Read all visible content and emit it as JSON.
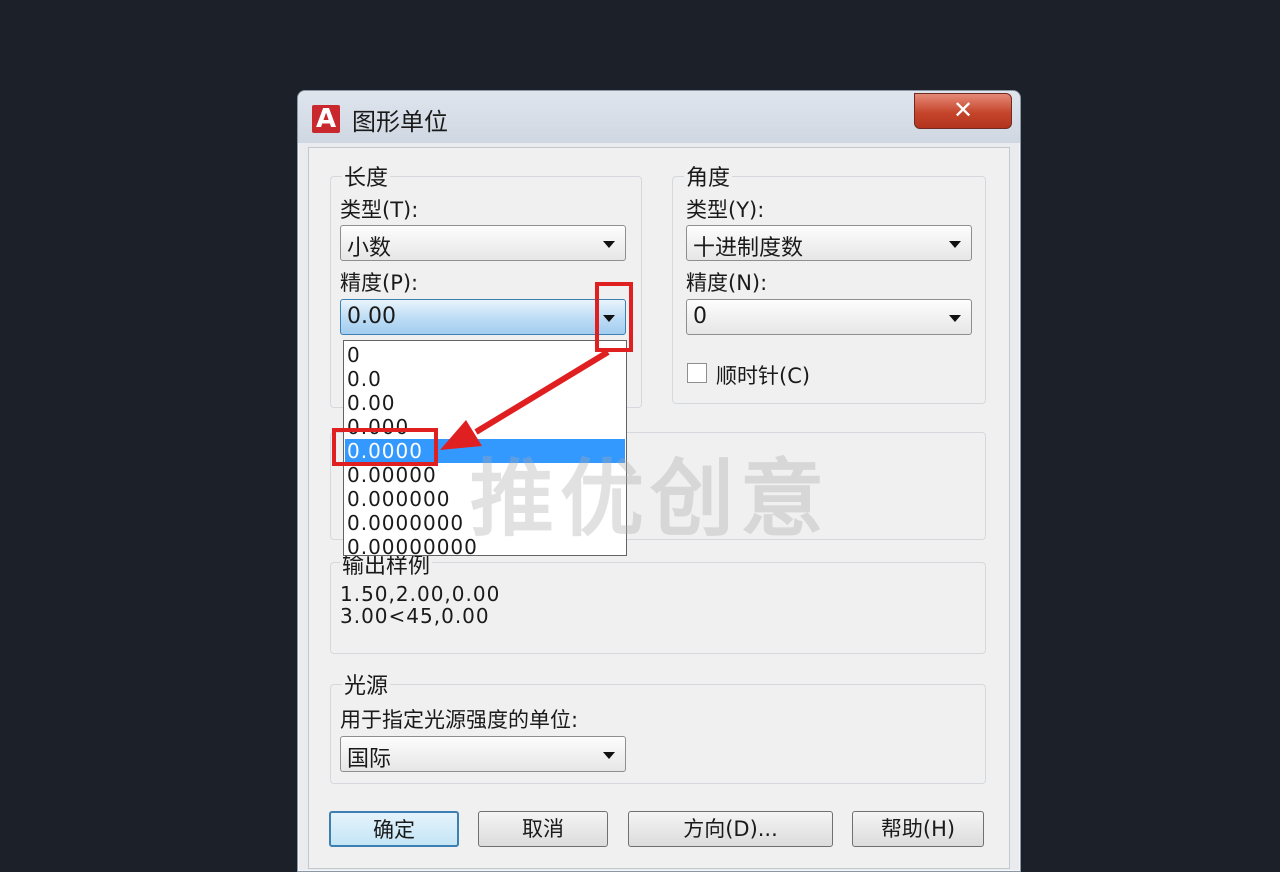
{
  "window": {
    "title": "图形单位",
    "close_label": "✕"
  },
  "length": {
    "group_label": "长度",
    "type_label": "类型(T):",
    "type_value": "小数",
    "precision_label": "精度(P):",
    "precision_value": "0.00",
    "precision_options": [
      "0",
      "0.0",
      "0.00",
      "0.000",
      "0.0000",
      "0.00000",
      "0.000000",
      "0.0000000",
      "0.00000000"
    ],
    "selected_option": "0.0000"
  },
  "angle": {
    "group_label": "角度",
    "type_label": "类型(Y):",
    "type_value": "十进制度数",
    "precision_label": "精度(N):",
    "precision_value": "0",
    "clockwise_label": "顺时针(C)"
  },
  "output_sample": {
    "group_label": "输出样例",
    "line1": "1.50,2.00,0.00",
    "line2": "3.00<45,0.00"
  },
  "lighting": {
    "group_label": "光源",
    "units_label": "用于指定光源强度的单位:",
    "units_value": "国际"
  },
  "buttons": {
    "ok": "确定",
    "cancel": "取消",
    "direction": "方向(D)...",
    "help": "帮助(H)"
  },
  "watermark": "推优创意",
  "colors": {
    "highlight": "#e02020",
    "selection": "#3399ff",
    "background": "#1c2129"
  }
}
